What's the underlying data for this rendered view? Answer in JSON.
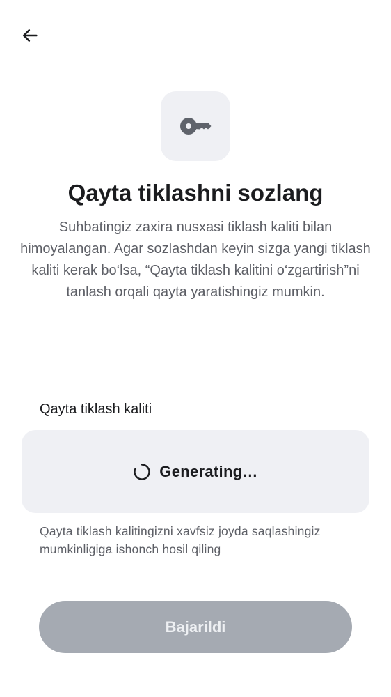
{
  "header": {
    "back_icon": "arrow-left-icon"
  },
  "hero": {
    "icon": "key-icon",
    "tile_color": "#eff0f4",
    "title": "Qayta tiklashni sozlang",
    "description": "Suhbatingiz zaxira nusxasi tiklash kaliti bilan himoyalangan. Agar sozlashdan keyin sizga yangi tiklash kaliti kerak bo‘lsa, “Qayta tiklash kalitini o‘zgartirish”ni tanlash orqali qayta yaratishingiz mumkin."
  },
  "recovery_key": {
    "label": "Qayta tiklash kaliti",
    "status_icon": "spinner-icon",
    "status_text": "Generating…",
    "hint": "Qayta tiklash kalitingizni xavfsiz joyda saqlashingiz mumkinligiga ishonch hosil qiling"
  },
  "actions": {
    "done_label": "Bajarildi",
    "done_enabled": false,
    "done_color": "#a5aab2"
  }
}
